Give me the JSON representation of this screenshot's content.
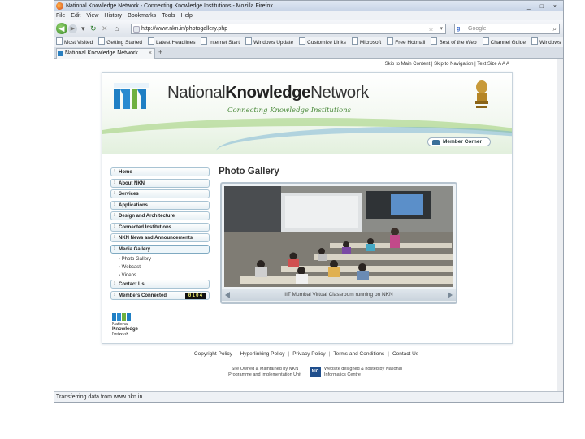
{
  "browser": {
    "window_title": "National Knowledge Network - Connecting Knowledge Institutions - Mozilla Firefox",
    "window_controls": "_ □ ×",
    "menu": [
      "File",
      "Edit",
      "View",
      "History",
      "Bookmarks",
      "Tools",
      "Help"
    ],
    "url": "http://www.nkn.in/photogallery.php",
    "search_placeholder": "Google",
    "search_engine_icon": "g",
    "bookmarks": [
      "Most Visited",
      "Getting Started",
      "Latest Headlines",
      "Internet Start",
      "Windows Update",
      "Customize Links",
      "Microsoft",
      "Free Hotmail",
      "Best of the Web",
      "Channel Guide",
      "Windows"
    ],
    "bookmarks_more": "»",
    "tab_title": "National Knowledge Network...",
    "tab_close": "×",
    "new_tab": "+",
    "status": "Transferring data from www.nkn.in..."
  },
  "site": {
    "skip_links": "Skip to Main Content | Skip to Navigation | Text Size A  A  A",
    "title_part1": "National",
    "title_part2": "Knowledge",
    "title_part3": "Network",
    "tagline": "Connecting Knowledge Institutions",
    "member_corner": "Member Corner",
    "menu": [
      {
        "label": "Home"
      },
      {
        "label": "About NKN"
      },
      {
        "label": "Services"
      },
      {
        "label": "Applications"
      },
      {
        "label": "Design and Architecture"
      },
      {
        "label": "Connected Institutions"
      },
      {
        "label": "NKN News and Announcements"
      },
      {
        "label": "Media Gallery"
      }
    ],
    "submenu": [
      "Photo Gallery",
      "Webcast",
      "Videos"
    ],
    "menu_after": [
      {
        "label": "Contact Us"
      },
      {
        "label": "Members Connected",
        "counter": "0104"
      }
    ],
    "small_logo_lines": [
      "National",
      "Knowledge",
      "Network"
    ],
    "gallery_title": "Photo Gallery",
    "photo_caption": "IIT Mumbai Virtual Classroom running on NKN",
    "footer_links": [
      "Copyright Policy",
      "Hyperlinking Policy",
      "Privacy Policy",
      "Terms and Conditions",
      "Contact Us"
    ],
    "credits_left": "Site Owned & Maintained by NKN Programme and Implementation Unit",
    "credits_nic": "NIC",
    "credits_right": "Website designed & hosted by National Informatics Centre"
  },
  "colors": {
    "brand_blue": "#1f7fc4",
    "brand_green": "#6fb03f",
    "menu_border": "#a8c3d3"
  }
}
